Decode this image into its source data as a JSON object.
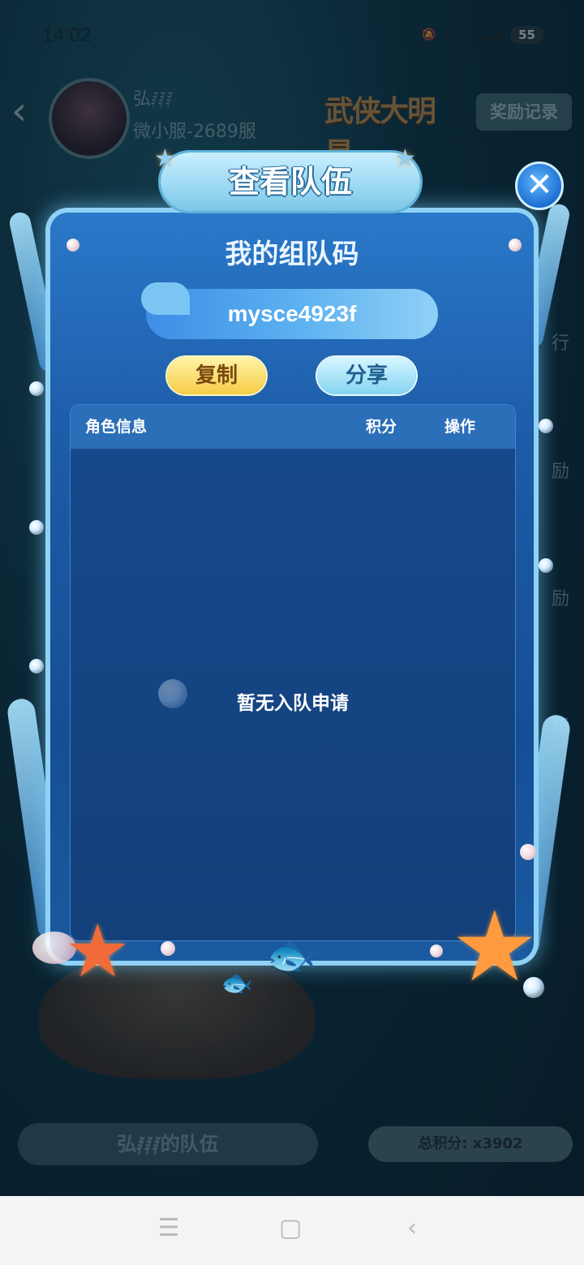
{
  "status_bar": {
    "time": "14:02",
    "network": "5GA",
    "battery": "55"
  },
  "header": {
    "player_name": "弘𝅁𝅁𝅁",
    "server": "微小服-2689服",
    "logo_text": "武侠大明星",
    "reward_record_label": "奖励记录"
  },
  "background": {
    "side_labels": [
      "行",
      "励",
      "励",
      "伍"
    ],
    "team_name": "弘𝅁𝅁𝅁的队伍",
    "total_score": "总积分: x3902"
  },
  "modal": {
    "title": "查看队伍",
    "close_symbol": "✕",
    "code_heading": "我的组队码",
    "team_code": "mysce4923f",
    "copy_label": "复制",
    "share_label": "分享",
    "table": {
      "columns": [
        "角色信息",
        "积分",
        "操作"
      ],
      "rows": [],
      "empty_message": "暂无入队申请"
    }
  },
  "nav_bar": {
    "menu_icon": "☰",
    "home_icon": "▢",
    "back_icon": "‹"
  },
  "colors": {
    "modal_blue": "#1d5ca8",
    "frame_glow": "#8fd2f5",
    "copy_yellow": "#f6cd46",
    "share_cyan": "#84d4f2"
  }
}
